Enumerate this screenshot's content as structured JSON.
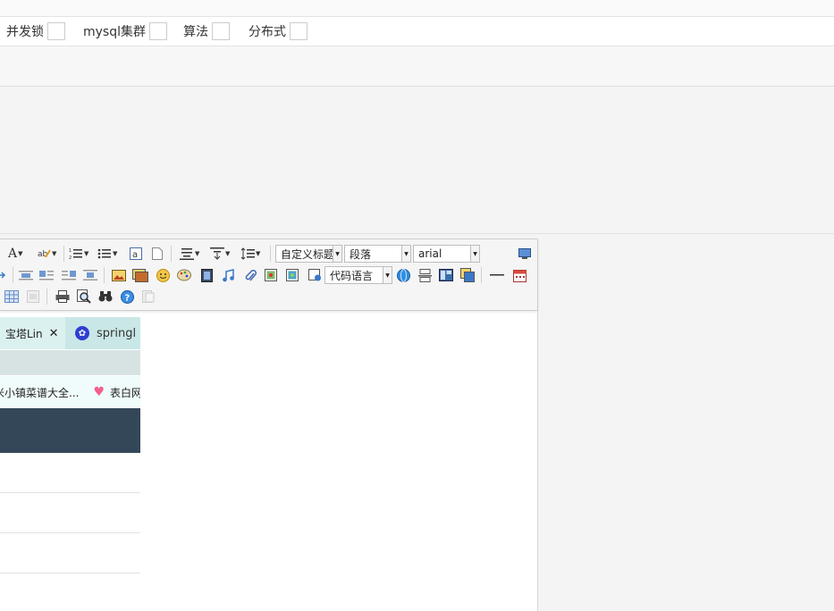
{
  "tags": [
    {
      "label": "并发锁"
    },
    {
      "label": "mysql集群"
    },
    {
      "label": "算法"
    },
    {
      "label": "分布式"
    }
  ],
  "toolbar": {
    "font_color_label": "A",
    "custom_title_value": "自定义标题",
    "paragraph_value": "段落",
    "font_family_value": "arial",
    "code_language_value": "代码语言"
  },
  "embedded_browser": {
    "tab1_label": "宝塔Lin",
    "tab1_close": "✕",
    "tab2_label": "springl",
    "bookmark1": "米小镇菜谱大全...",
    "bookmark2": "表白网"
  },
  "colors": {
    "page_bg": "#f4f4f4",
    "toolbar_bg": "#f5f5f5",
    "tab_bar": "#c9e7e6",
    "dark_header": "#344759",
    "heart": "#f25f8a"
  }
}
